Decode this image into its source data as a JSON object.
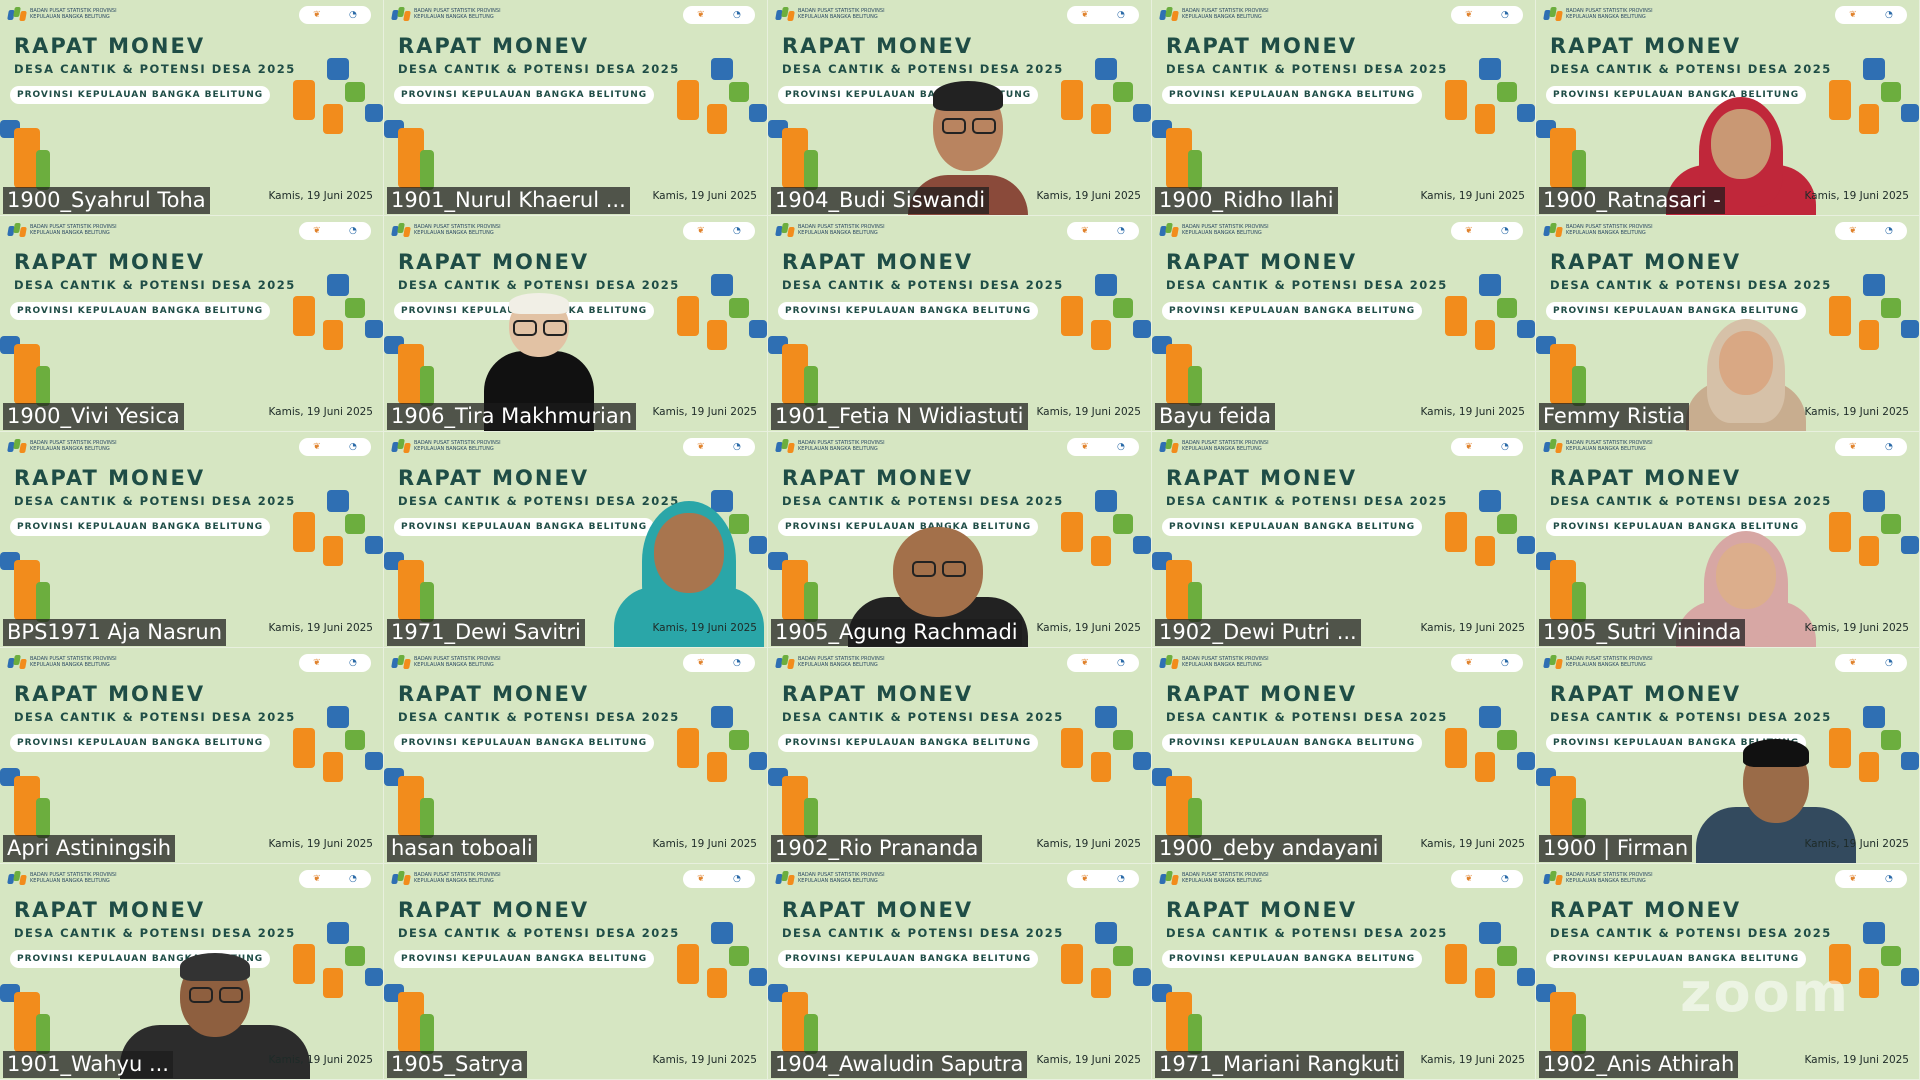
{
  "meeting": {
    "banner_title": "RAPAT MONEV",
    "banner_subtitle": "DESA CANTIK & POTENSI DESA 2025",
    "banner_province": "PROVINSI KEPULAUAN BANGKA BELITUNG",
    "banner_org": "BADAN PUSAT STATISTIK PROVINSI KEPULAUAN BANGKA BELITUNG",
    "banner_date": "Kamis, 19 Juni 2025",
    "watermark": "zoom"
  },
  "colors": {
    "tile_bg": "#d6e6c2",
    "accent_blue": "#2f6fb3",
    "accent_green": "#6cae3e",
    "accent_orange": "#f28c1c",
    "title_text": "#1f4d46",
    "label_bg": "#1c1c1c"
  },
  "participants": [
    {
      "name": "1900_Syahrul Toha",
      "video": "none"
    },
    {
      "name": "1901_Nurul Khaerul ...",
      "video": "none"
    },
    {
      "name": "1904_Budi Siswandi",
      "video": "man-glasses"
    },
    {
      "name": "1900_Ridho Ilahi",
      "video": "none"
    },
    {
      "name": "1900_Ratnasari -",
      "video": "woman-red-hijab"
    },
    {
      "name": "1900_Vivi Yesica",
      "video": "none"
    },
    {
      "name": "1906_Tira Makhmurian",
      "video": "avatar-hat"
    },
    {
      "name": "1901_Fetia N Widiastuti",
      "video": "none"
    },
    {
      "name": "Bayu feida",
      "video": "none"
    },
    {
      "name": "Femmy Ristia",
      "video": "woman-beige-hijab"
    },
    {
      "name": "BPS1971 Aja Nasrun",
      "video": "none"
    },
    {
      "name": "1971_Dewi Savitri",
      "video": "woman-teal-hijab"
    },
    {
      "name": "1905_Agung Rachmadi",
      "video": "man-bald"
    },
    {
      "name": "1902_Dewi Putri ...",
      "video": "none"
    },
    {
      "name": "1905_Sutri Vininda",
      "video": "woman-pink-hijab"
    },
    {
      "name": "Apri Astiningsih",
      "video": "none"
    },
    {
      "name": "hasan toboali",
      "video": "none"
    },
    {
      "name": "1902_Rio Prananda",
      "video": "none"
    },
    {
      "name": "1900_deby andayani",
      "video": "none"
    },
    {
      "name": "1900 | Firman",
      "video": "man-headset"
    },
    {
      "name": "1901_Wahyu ...",
      "video": "man-glasses-2"
    },
    {
      "name": "1905_Satrya",
      "video": "none"
    },
    {
      "name": "1904_Awaludin Saputra",
      "video": "none"
    },
    {
      "name": "1971_Mariani Rangkuti",
      "video": "none"
    },
    {
      "name": "1902_Anis Athirah",
      "video": "none"
    }
  ]
}
